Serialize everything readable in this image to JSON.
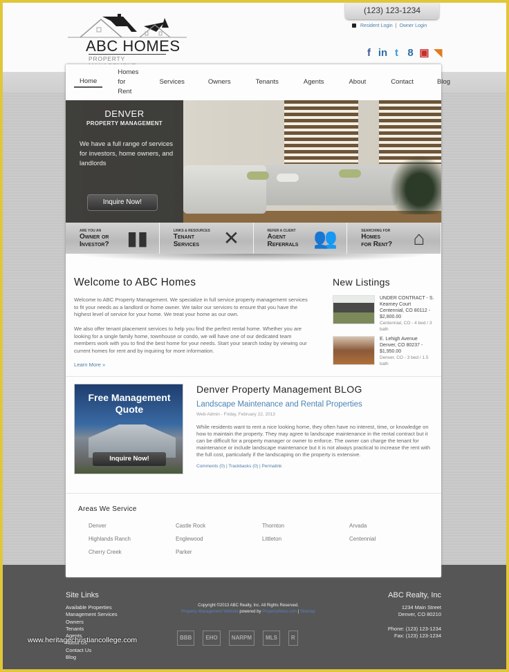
{
  "header": {
    "logo": {
      "brand": "ABC HOMES",
      "tagline": "PROPERTY MANAGEMENT"
    },
    "phone": "(123) 123-1234",
    "logins": {
      "resident": "Resident Login",
      "separator": "|",
      "owner": "Owner Login"
    },
    "social": [
      {
        "name": "facebook-icon",
        "glyph": "f",
        "color": "#3b5998"
      },
      {
        "name": "linkedin-icon",
        "glyph": "in",
        "color": "#2a6fa8"
      },
      {
        "name": "twitter-icon",
        "glyph": "t",
        "color": "#3a9ad9"
      },
      {
        "name": "google-icon",
        "glyph": "8",
        "color": "#2a6fa8"
      },
      {
        "name": "youtube-icon",
        "glyph": "▣",
        "color": "#c4302b"
      },
      {
        "name": "rss-icon",
        "glyph": "◥",
        "color": "#e27a1f"
      }
    ]
  },
  "nav": {
    "items": [
      "Home",
      "Homes for Rent",
      "Services",
      "Owners",
      "Tenants",
      "Agents",
      "About",
      "Contact",
      "Blog"
    ],
    "active": "Home"
  },
  "hero": {
    "title": "DENVER",
    "subtitle": "PROPERTY MANAGEMENT",
    "description": "We have a full range of services for investors, home owners, and landlords",
    "button": "Inquire Now!"
  },
  "tiles": [
    {
      "small": "ARE YOU AN",
      "big1": "Owner or",
      "big2": "Investor?",
      "icon": "bar-chart-icon",
      "glyph": "▮▮"
    },
    {
      "small": "LINKS & RESOURCES",
      "big1": "Tenant",
      "big2": "Services",
      "icon": "tools-icon",
      "glyph": "✕"
    },
    {
      "small": "REFER A CLIENT",
      "big1": "Agent",
      "big2": "Referrals",
      "icon": "users-icon",
      "glyph": "👥"
    },
    {
      "small": "SEARCHING FOR",
      "big1": "Homes",
      "big2": "for Rent?",
      "icon": "house-icon",
      "glyph": "⌂"
    }
  ],
  "welcome": {
    "title": "Welcome to ABC Homes",
    "p1": "Welcome to ABC Property Management. We specialize in full service property management services to fit your needs as a landlord or home owner. We tailor our services to ensure that you have the highest level of service for your home. We treat your home as our own.",
    "p2": "We also offer tenant placement services to help you find the perfect rental home. Whether you are looking for a single family home, townhouse or condo, we will have one of our dedicated team members work with you to find the best home for your needs. Start your search today by viewing our current homes for rent and by inquiring for more information.",
    "learn_more": "Learn More »"
  },
  "listings": {
    "title": "New Listings",
    "items": [
      {
        "headline": "UNDER CONTRACT - S. Kearney Court Centennial, CO 80112 - $2,800.00",
        "details": "Centennial, CO - 4 bed / 3 bath"
      },
      {
        "headline": "E. Lehigh Avenue Denver, CO 80237 - $1,950.00",
        "details": "Denver, CO - 3 bed / 1.5 bath"
      }
    ]
  },
  "promo": {
    "title": "Free Management Quote",
    "button": "Inquire Now!"
  },
  "blog": {
    "title": "Denver Property Management BLOG",
    "post_title": "Landscape Maintenance and Rental Properties",
    "meta": "Web-Admin - Friday, February 22, 2013",
    "body": "While residents want to rent a nice looking home, they often have no interest, time, or knowledge on how to maintain the property. They may agree to landscape maintenance in the rental contract but it can be difficult for a property manager or owner to enforce. The owner can charge the tenant for maintenance or include landscape maintenance but it is not always practical to increase the rent with the full cost, particularly if the landscaping on the property is extensive.",
    "links": {
      "comments": "Comments (0)",
      "trackbacks": "Trackbacks (0)",
      "permalink": "Permalink",
      "sep": "|"
    }
  },
  "areas": {
    "title": "Areas We Service",
    "items": [
      "Denver",
      "Castle Rock",
      "Thornton",
      "Arvada",
      "Highlands Ranch",
      "Englewood",
      "Littleton",
      "Centennial",
      "Cherry Creek",
      "Parker"
    ]
  },
  "footer": {
    "site_links_title": "Site Links",
    "site_links": [
      "Available Properties",
      "Management Services",
      "Owners",
      "Tenants",
      "Agents",
      "About Us",
      "Contact Us",
      "Blog"
    ],
    "copyright": "Copyright ©2013 ABC Realty, Inc. All Rights Reserved.",
    "powered": {
      "left_link": "Property Management Website",
      "text": "powered by",
      "right_link": "PropertyWare.com",
      "sep": "|",
      "end_link": "Sitemap"
    },
    "badges": [
      "BBB",
      "EHO",
      "NARPM",
      "MLS",
      "R"
    ],
    "company": "ABC Realty, Inc",
    "address1": "1234 Main Street",
    "address2": "Denver, CO 80210",
    "phone": "Phone: (123) 123-1234",
    "fax": "Fax: (123) 123-1234"
  },
  "watermark": "www.heritagechristiancollege.com"
}
